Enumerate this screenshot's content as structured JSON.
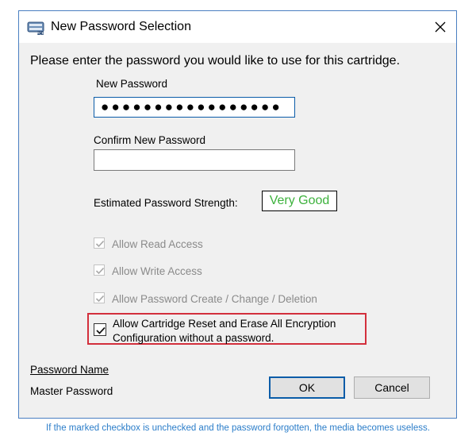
{
  "window": {
    "title": "New Password Selection",
    "app_icon": "cartridge-lock-icon",
    "close_icon": "close-icon"
  },
  "instruction": "Please enter the password you would like to use for this cartridge.",
  "new_password": {
    "label": "New Password",
    "value": "●●●●●●●●●●●●●●●●●"
  },
  "confirm_password": {
    "label": "Confirm New Password",
    "value": ""
  },
  "strength": {
    "label": "Estimated Password Strength:",
    "value": "Very Good",
    "color": "#3db23d"
  },
  "permissions": [
    {
      "label": "Allow Read Access",
      "checked": true,
      "enabled": false
    },
    {
      "label": "Allow Write Access",
      "checked": true,
      "enabled": false
    },
    {
      "label": "Allow Password Create / Change / Deletion",
      "checked": true,
      "enabled": false
    }
  ],
  "reset_option": {
    "line1": "Allow Cartridge Reset and Erase All Encryption",
    "line2": "Configuration without a password.",
    "checked": true,
    "enabled": true,
    "highlight_color": "#d32f3c"
  },
  "password_name": {
    "title": "Password Name",
    "value": "Master Password"
  },
  "buttons": {
    "ok": "OK",
    "cancel": "Cancel"
  },
  "caption": "If the marked checkbox is unchecked and the password forgotten, the media becomes useless."
}
